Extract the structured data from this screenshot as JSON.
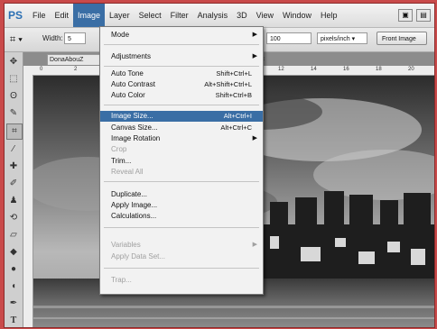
{
  "app": {
    "logo_text": "PS"
  },
  "menubar": {
    "items": [
      "File",
      "Edit",
      "Image",
      "Layer",
      "Select",
      "Filter",
      "Analysis",
      "3D",
      "View",
      "Window",
      "Help"
    ],
    "active_index": 2
  },
  "options_bar": {
    "width_label": "Width:",
    "width_value": "5",
    "resolution_value": "100",
    "resolution_unit": "pixels/inch",
    "front_image_label": "Front Image"
  },
  "document": {
    "tab_title": "DonaAbouZ",
    "tab_close": "×",
    "ruler_ticks": [
      "0",
      "2",
      "12",
      "14",
      "16",
      "18",
      "20"
    ]
  },
  "image_menu": {
    "items": [
      {
        "label": "Mode",
        "submenu": true
      },
      {
        "separator": true
      },
      {
        "label": "Adjustments",
        "submenu": true
      },
      {
        "separator": true
      },
      {
        "label": "Auto Tone",
        "shortcut": "Shift+Ctrl+L"
      },
      {
        "label": "Auto Contrast",
        "shortcut": "Alt+Shift+Ctrl+L"
      },
      {
        "label": "Auto Color",
        "shortcut": "Shift+Ctrl+B"
      },
      {
        "separator": true
      },
      {
        "label": "Image Size...",
        "shortcut": "Alt+Ctrl+I",
        "highlighted": true
      },
      {
        "label": "Canvas Size...",
        "shortcut": "Alt+Ctrl+C"
      },
      {
        "label": "Image Rotation",
        "submenu": true
      },
      {
        "label": "Crop",
        "disabled": true
      },
      {
        "label": "Trim..."
      },
      {
        "label": "Reveal All",
        "disabled": true
      },
      {
        "separator": true
      },
      {
        "label": "Duplicate..."
      },
      {
        "label": "Apply Image..."
      },
      {
        "label": "Calculations..."
      },
      {
        "separator": true
      },
      {
        "label": "Variables",
        "submenu": true,
        "disabled": true
      },
      {
        "label": "Apply Data Set...",
        "disabled": true
      },
      {
        "separator": true
      },
      {
        "label": "Trap...",
        "disabled": true
      }
    ]
  },
  "tools": [
    "move-tool",
    "marquee-tool",
    "lasso-tool",
    "quick-select-tool",
    "crop-tool",
    "eyedropper-tool",
    "healing-tool",
    "brush-tool",
    "clone-stamp-tool",
    "history-brush-tool",
    "eraser-tool",
    "gradient-tool",
    "blur-tool",
    "dodge-tool",
    "pen-tool",
    "type-tool"
  ]
}
